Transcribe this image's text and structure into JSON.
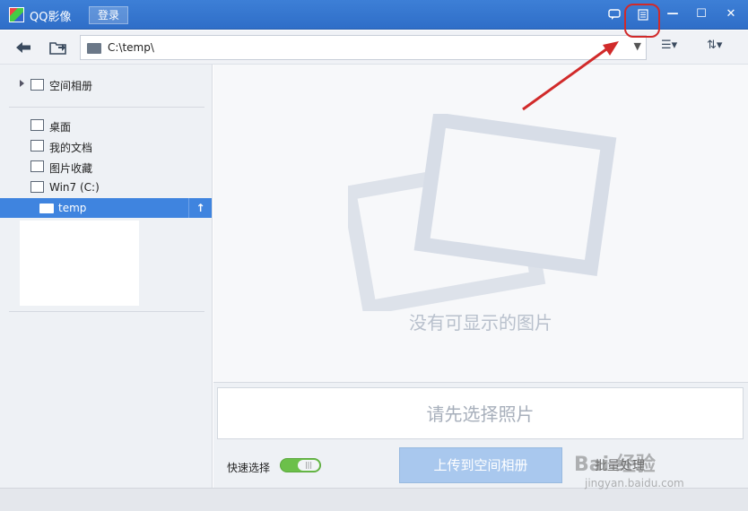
{
  "titlebar": {
    "app_title": "QQ影像",
    "login_label": "登录",
    "feedback_icon": "chat-bubble-icon",
    "mini_icon": "mini-mode-icon",
    "min_label": "—",
    "max_label": "☐",
    "close_label": "✕"
  },
  "toolbar": {
    "back_glyph": "🡄",
    "path_value": "C:\\temp\\",
    "path_dropdown": "▼",
    "view_glyph": "☰▾",
    "sort_glyph": "⇅▾"
  },
  "sidebar": {
    "album_label": "空间相册",
    "items": [
      {
        "label": "桌面",
        "icon": "desktop-icon"
      },
      {
        "label": "我的文档",
        "icon": "documents-icon"
      },
      {
        "label": "图片收藏",
        "icon": "pictures-icon"
      },
      {
        "label": "Win7 (C:)",
        "icon": "drive-icon"
      }
    ],
    "selected_label": "temp",
    "up_glyph": "↑"
  },
  "main": {
    "empty_text": "没有可显示的图片"
  },
  "bottom": {
    "select_first": "请先选择照片",
    "quick_select_label": "快速选择",
    "upload_label": "上传到空间相册",
    "batch_label": "批量处理"
  },
  "watermark": {
    "logo_text": "Bai 经验",
    "url": "jingyan.baidu.com"
  },
  "colors": {
    "titlebar": "#3377d0",
    "selected": "#3f84df",
    "annotation": "#d12a2a"
  }
}
